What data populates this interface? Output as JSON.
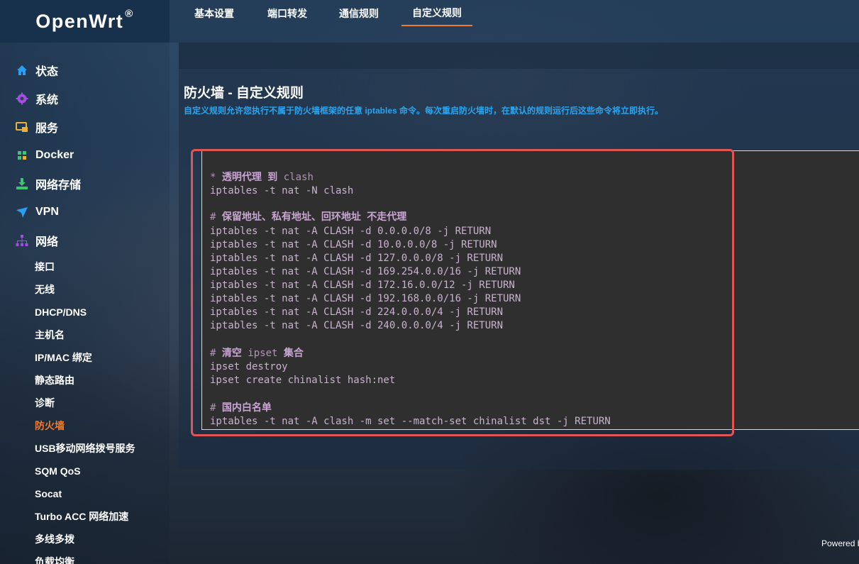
{
  "brand": {
    "name": "OpenWrt",
    "reg": "®"
  },
  "sidebar": {
    "menus": [
      {
        "label": "状态",
        "icon": "home-icon",
        "color": "#2a9df4"
      },
      {
        "label": "系统",
        "icon": "gear-icon",
        "color": "#a44de0"
      },
      {
        "label": "服务",
        "icon": "services-icon",
        "color": "#e8b23a"
      },
      {
        "label": "Docker",
        "icon": "docker-icon",
        "color": "#3ec46d"
      },
      {
        "label": "网络存储",
        "icon": "download-icon",
        "color": "#3ec46d"
      },
      {
        "label": "VPN",
        "icon": "vpn-icon",
        "color": "#2a9df4"
      },
      {
        "label": "网络",
        "icon": "network-icon",
        "color": "#a44de0"
      }
    ],
    "network_items": [
      {
        "label": "接口"
      },
      {
        "label": "无线"
      },
      {
        "label": "DHCP/DNS"
      },
      {
        "label": "主机名"
      },
      {
        "label": "IP/MAC 绑定"
      },
      {
        "label": "静态路由"
      },
      {
        "label": "诊断"
      },
      {
        "label": "防火墙",
        "active": true
      },
      {
        "label": "USB移动网络拨号服务"
      },
      {
        "label": "SQM QoS"
      },
      {
        "label": "Socat"
      },
      {
        "label": "Turbo ACC 网络加速"
      },
      {
        "label": "多线多拨"
      },
      {
        "label": "负载均衡"
      }
    ]
  },
  "tabs": [
    {
      "label": "基本设置"
    },
    {
      "label": "端口转发"
    },
    {
      "label": "通信规则"
    },
    {
      "label": "自定义规则",
      "active": true
    }
  ],
  "page": {
    "title": "防火墙 - 自定义规则",
    "description": "自定义规则允许您执行不属于防火墙框架的任意 iptables 命令。每次重启防火墙时，在默认的规则运行后这些命令将立即执行。"
  },
  "editor": {
    "lines": [
      {
        "text": "",
        "comment": false
      },
      {
        "text": "* 透明代理 到 clash",
        "comment": true
      },
      {
        "text": "iptables -t nat -N clash",
        "comment": false
      },
      {
        "text": "",
        "comment": false
      },
      {
        "text": "# 保留地址、私有地址、回环地址 不走代理",
        "comment": true
      },
      {
        "text": "iptables -t nat -A CLASH -d 0.0.0.0/8 -j RETURN",
        "comment": false
      },
      {
        "text": "iptables -t nat -A CLASH -d 10.0.0.0/8 -j RETURN",
        "comment": false
      },
      {
        "text": "iptables -t nat -A CLASH -d 127.0.0.0/8 -j RETURN",
        "comment": false
      },
      {
        "text": "iptables -t nat -A CLASH -d 169.254.0.0/16 -j RETURN",
        "comment": false
      },
      {
        "text": "iptables -t nat -A CLASH -d 172.16.0.0/12 -j RETURN",
        "comment": false
      },
      {
        "text": "iptables -t nat -A CLASH -d 192.168.0.0/16 -j RETURN",
        "comment": false
      },
      {
        "text": "iptables -t nat -A CLASH -d 224.0.0.0/4 -j RETURN",
        "comment": false
      },
      {
        "text": "iptables -t nat -A CLASH -d 240.0.0.0/4 -j RETURN",
        "comment": false
      },
      {
        "text": "",
        "comment": false
      },
      {
        "text": "# 清空 ipset 集合",
        "comment": true
      },
      {
        "text": "ipset destroy",
        "comment": false
      },
      {
        "text": "ipset create chinalist hash:net",
        "comment": false
      },
      {
        "text": "",
        "comment": false
      },
      {
        "text": "# 国内白名单",
        "comment": true
      },
      {
        "text": "iptables -t nat -A clash -m set --match-set chinalist dst -j RETURN",
        "comment": false
      }
    ]
  },
  "footer": {
    "powered": "Powered by"
  }
}
